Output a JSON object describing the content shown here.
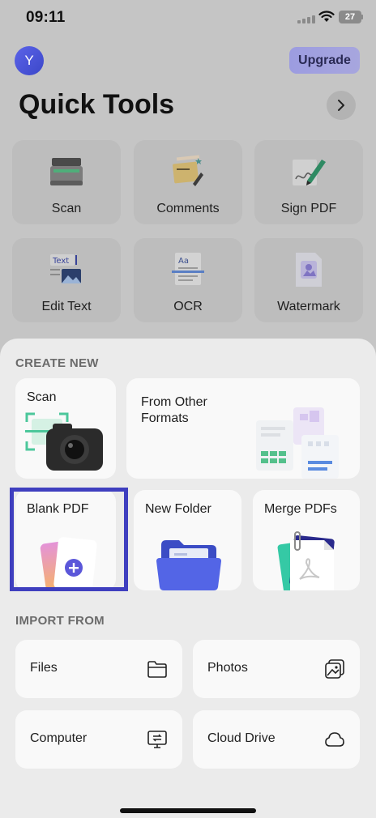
{
  "status_bar": {
    "time": "09:11",
    "battery": "27"
  },
  "header": {
    "avatar_initial": "Y",
    "upgrade_label": "Upgrade",
    "title": "Quick Tools"
  },
  "quick_tools": [
    {
      "label": "Scan",
      "icon": "scanner-icon"
    },
    {
      "label": "Comments",
      "icon": "sticky-note-icon"
    },
    {
      "label": "Sign PDF",
      "icon": "signature-pen-icon"
    },
    {
      "label": "Edit Text",
      "icon": "edit-text-icon"
    },
    {
      "label": "OCR",
      "icon": "ocr-icon"
    },
    {
      "label": "Watermark",
      "icon": "watermark-icon"
    }
  ],
  "create_new": {
    "heading": "CREATE NEW",
    "items": [
      {
        "label": "Scan",
        "icon": "camera-icon"
      },
      {
        "label_line1": "From Other",
        "label_line2": "Formats",
        "icon": "documents-icon"
      },
      {
        "label": "Blank PDF",
        "icon": "blank-pdf-plus-icon"
      },
      {
        "label": "New Folder",
        "icon": "folder-icon"
      },
      {
        "label": "Merge PDFs",
        "icon": "merge-pdf-icon"
      }
    ]
  },
  "import_from": {
    "heading": "IMPORT FROM",
    "items": [
      {
        "label": "Files",
        "icon": "folder-outline-icon"
      },
      {
        "label": "Photos",
        "icon": "photos-icon"
      },
      {
        "label": "Computer",
        "icon": "computer-transfer-icon"
      },
      {
        "label": "Cloud Drive",
        "icon": "cloud-icon"
      }
    ]
  },
  "colors": {
    "accent": "#3f3fbf",
    "overlay": "#c5c5c5",
    "sheet": "#ebebeb",
    "card": "#f9f9f9"
  }
}
